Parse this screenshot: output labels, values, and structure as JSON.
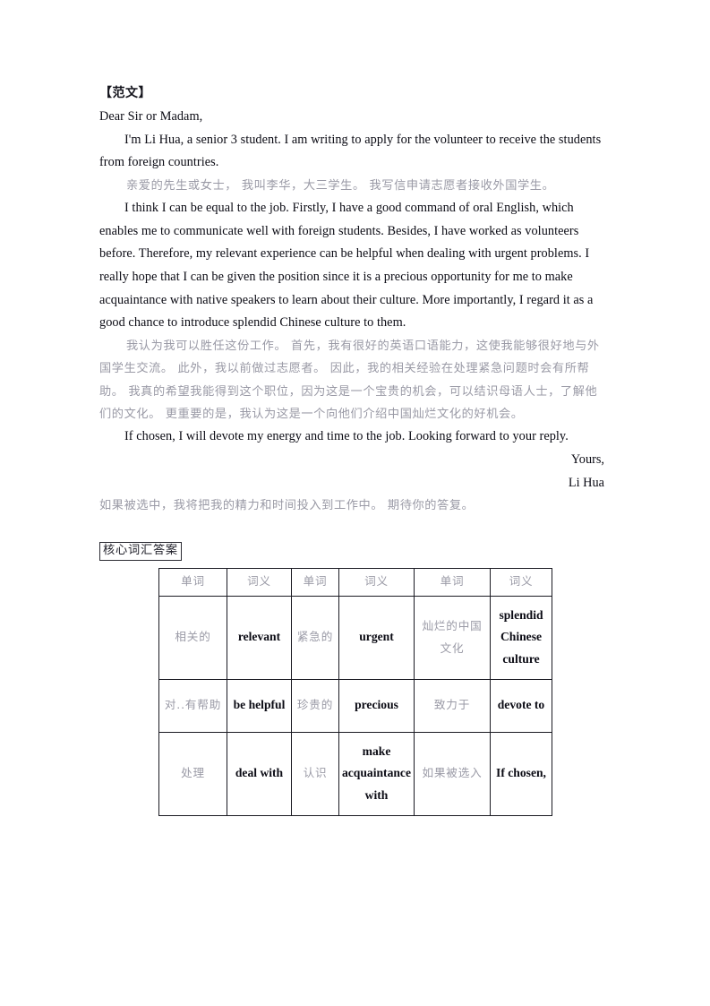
{
  "document": {
    "heading": "【范文】",
    "salutation": "Dear Sir or Madam,",
    "paragraph1_en": "I'm Li Hua, a senior 3 student. I am writing to apply for the volunteer to receive the students from foreign countries.",
    "paragraph1_zh": "亲爱的先生或女士， 我叫李华，大三学生。 我写信申请志愿者接收外国学生。",
    "paragraph2_en": "I think I can be equal to the job. Firstly, I have a good command of oral English, which enables me to communicate well with foreign students. Besides, I have worked as volunteers before. Therefore, my relevant experience can be helpful when dealing with urgent problems. I really hope that I can be given the position since it is a precious opportunity for me to make acquaintance with native speakers to learn about their culture. More importantly, I regard it as a good chance to introduce splendid Chinese culture to them.",
    "paragraph2_zh": "我认为我可以胜任这份工作。 首先，我有很好的英语口语能力，这使我能够很好地与外国学生交流。 此外，我以前做过志愿者。 因此，我的相关经验在处理紧急问题时会有所帮助。 我真的希望我能得到这个职位，因为这是一个宝贵的机会，可以结识母语人士，了解他们的文化。 更重要的是，我认为这是一个向他们介绍中国灿烂文化的好机会。",
    "paragraph3_en": "If chosen, I will devote my energy and time to the job. Looking forward to your reply.",
    "signoff_yours": "Yours,",
    "signoff_name": "Li Hua",
    "paragraph3_zh": "如果被选中，我将把我的精力和时间投入到工作中。 期待你的答复。"
  },
  "vocab_section": {
    "boxed_label": "核心词汇答案",
    "table": {
      "headers": [
        "单词",
        "词义",
        "单词",
        "词义",
        "单词",
        "词义"
      ],
      "rows": [
        [
          "相关的",
          "relevant",
          "紧急的",
          "urgent",
          "灿烂的中国文化",
          "splendid Chinese culture"
        ],
        [
          "对..有帮助",
          "be helpful",
          "珍贵的",
          "precious",
          "致力于",
          "devote to"
        ],
        [
          "处理",
          "deal with",
          "认识",
          "make acquaintance with",
          "如果被选入",
          "If chosen,"
        ]
      ]
    }
  },
  "colors": {
    "english_text": "#0b0b14",
    "chinese_text": "#9a9aa6",
    "heading_text": "#16161e",
    "table_border": "#1a1a22",
    "page_background": "#ffffff"
  }
}
